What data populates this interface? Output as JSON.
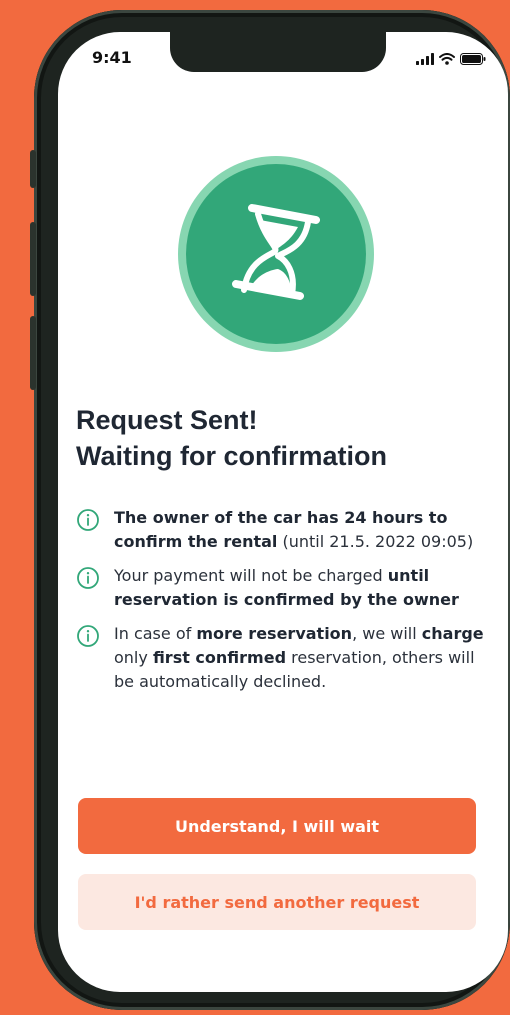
{
  "status_bar": {
    "time": "9:41",
    "icons": [
      "signal-icon",
      "wifi-icon",
      "battery-icon"
    ]
  },
  "illustration": {
    "icon": "hourglass-icon",
    "colors": {
      "outer": "#87d6b1",
      "inner": "#32a779",
      "glyph": "#ffffff"
    }
  },
  "heading": {
    "line1": "Request Sent!",
    "line2": "Waiting for confirmation"
  },
  "info_items": [
    {
      "icon": "info-icon",
      "segments": [
        {
          "text": "The owner of the car has 24 hours to confirm the rental",
          "bold": true
        },
        {
          "text": " (until 21.5. 2022 09:05)",
          "bold": false
        }
      ]
    },
    {
      "icon": "info-icon",
      "segments": [
        {
          "text": "Your payment will not be charged ",
          "bold": false
        },
        {
          "text": "until reservation is confirmed by the owner",
          "bold": true
        }
      ]
    },
    {
      "icon": "info-icon",
      "segments": [
        {
          "text": "In case of ",
          "bold": false
        },
        {
          "text": "more reservation",
          "bold": true
        },
        {
          "text": ", we will ",
          "bold": false
        },
        {
          "text": "charge",
          "bold": true
        },
        {
          "text": " only ",
          "bold": false
        },
        {
          "text": "first confirmed",
          "bold": true
        },
        {
          "text": " reservation, others will be automatically declined.",
          "bold": false
        }
      ]
    }
  ],
  "buttons": {
    "primary": "Understand, I will wait",
    "secondary": "I'd rather send another request"
  },
  "colors": {
    "accent": "#f26a3f",
    "success": "#32a779",
    "secondary_bg": "#fce8e1"
  }
}
